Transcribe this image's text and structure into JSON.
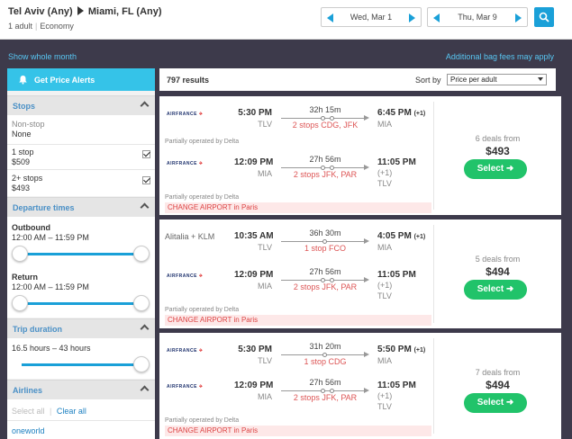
{
  "header": {
    "origin": "Tel Aviv (Any)",
    "destination": "Miami, FL (Any)",
    "travelers": "1 adult",
    "cabin": "Economy",
    "depart_date": "Wed, Mar 1",
    "return_date": "Thu, Mar 9"
  },
  "links": {
    "show_month": "Show whole month",
    "bag_fees": "Additional bag fees may apply"
  },
  "sidebar": {
    "alert_button": "Get Price Alerts",
    "stops_title": "Stops",
    "stops": [
      {
        "label": "Non-stop",
        "value": "None"
      },
      {
        "label": "1 stop",
        "value": "$509"
      },
      {
        "label": "2+ stops",
        "value": "$493"
      }
    ],
    "departure_title": "Departure times",
    "outbound_label": "Outbound",
    "outbound_range": "12:00 AM – 11:59 PM",
    "return_label": "Return",
    "return_range": "12:00 AM – 11:59 PM",
    "duration_title": "Trip duration",
    "duration_range": "16.5 hours – 43 hours",
    "airlines_title": "Airlines",
    "select_all": "Select all",
    "clear_all": "Clear all",
    "first_airline": "oneworld"
  },
  "results": {
    "count": "797 results",
    "sort_label": "Sort by",
    "sort_value": "Price per adult",
    "cards": [
      {
        "legs": [
          {
            "airline": "AIRFRANCE",
            "dep_time": "5:30 PM",
            "dep_ap": "TLV",
            "duration": "32h 15m",
            "stops": "2 stops CDG, JFK",
            "arr_time": "6:45 PM",
            "arr_plus": "(+1)",
            "arr_ap": "MIA"
          },
          {
            "airline": "AIRFRANCE",
            "dep_time": "12:09 PM",
            "dep_ap": "MIA",
            "duration": "27h 56m",
            "stops": "2 stops JFK, PAR",
            "arr_time": "11:05 PM",
            "arr_plus": "(+1)",
            "arr_ap": "TLV"
          }
        ],
        "notes": [
          "Partially operated by Delta",
          "Partially operated by Delta"
        ],
        "warning": "CHANGE AIRPORT in Paris",
        "deals": "6 deals from",
        "price": "$493",
        "select": "Select ➜"
      },
      {
        "legs": [
          {
            "airline": "Alitalia + KLM",
            "dep_time": "10:35 AM",
            "dep_ap": "TLV",
            "duration": "36h 30m",
            "stops": "1 stop FCO",
            "arr_time": "4:05 PM",
            "arr_plus": "(+1)",
            "arr_ap": "MIA"
          },
          {
            "airline": "AIRFRANCE",
            "dep_time": "12:09 PM",
            "dep_ap": "MIA",
            "duration": "27h 56m",
            "stops": "2 stops JFK, PAR",
            "arr_time": "11:05 PM",
            "arr_plus": "(+1)",
            "arr_ap": "TLV"
          }
        ],
        "notes": [
          "Partially operated by Delta"
        ],
        "warning": "CHANGE AIRPORT in Paris",
        "deals": "5 deals from",
        "price": "$494",
        "select": "Select ➜"
      },
      {
        "legs": [
          {
            "airline": "AIRFRANCE",
            "dep_time": "5:30 PM",
            "dep_ap": "TLV",
            "duration": "31h 20m",
            "stops": "1 stop CDG",
            "arr_time": "5:50 PM",
            "arr_plus": "(+1)",
            "arr_ap": "MIA"
          },
          {
            "airline": "AIRFRANCE",
            "dep_time": "12:09 PM",
            "dep_ap": "MIA",
            "duration": "27h 56m",
            "stops": "2 stops JFK, PAR",
            "arr_time": "11:05 PM",
            "arr_plus": "(+1)",
            "arr_ap": "TLV"
          }
        ],
        "notes": [
          "Partially operated by Delta"
        ],
        "warning": "CHANGE AIRPORT in Paris",
        "deals": "7 deals from",
        "price": "$494",
        "select": "Select ➜"
      }
    ]
  },
  "colors": {
    "accent": "#1aa0d8",
    "select_green": "#21c36a",
    "alert_blue": "#35c3e8",
    "stops_red": "#dd5555",
    "page_dark": "#3d3a4b"
  }
}
